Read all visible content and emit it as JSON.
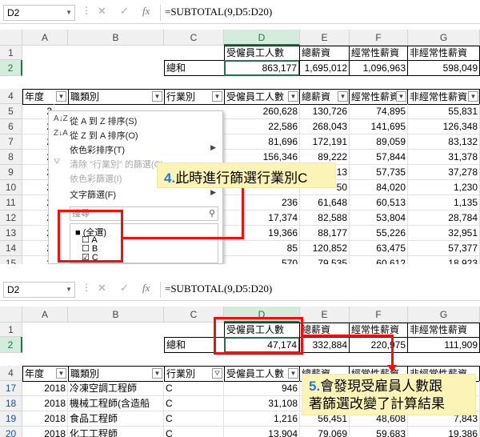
{
  "top": {
    "namebox": "D2",
    "fx": "fx",
    "formula": "=SUBTOTAL(9,D5:D20)",
    "cols": [
      "A",
      "B",
      "C",
      "D",
      "E",
      "F",
      "G"
    ],
    "rows": [
      "1",
      "2",
      "4",
      "5",
      "6",
      "7",
      "8",
      "9",
      "10",
      "11",
      "12",
      "13",
      "14",
      "15"
    ],
    "row1": {
      "d": "受僱員工人數",
      "e": "總薪資",
      "f": "經常性薪資",
      "g": "非經常性薪資"
    },
    "row2": {
      "c": "總和",
      "d": "863,177",
      "e": "1,695,012",
      "f": "1,096,963",
      "g": "598,049"
    },
    "row4": {
      "a": "年度",
      "b": "職類別",
      "c": "行業別",
      "d": "受僱員工人數",
      "e": "總薪資",
      "f": "經常性薪資",
      "g": "非經常性薪資"
    },
    "a_partial": [
      "2",
      "2",
      "2",
      "2",
      "2",
      "2",
      "2",
      "2",
      "2",
      "2",
      "2"
    ],
    "d_vals": [
      "260,628",
      "22,586",
      "81,696",
      "156,346",
      "",
      "",
      "236",
      "17,374",
      "19,366",
      "85",
      "570"
    ],
    "e_vals": [
      "130,726",
      "268,043",
      "172,191",
      "89,222",
      "13",
      "50",
      "61,648",
      "82,588",
      "88,177",
      "120,852",
      "79,535"
    ],
    "f_vals": [
      "74,895",
      "141,695",
      "89,059",
      "57,844",
      "57,735",
      "84,020",
      "60,513",
      "53,804",
      "55,226",
      "63,475",
      "60,612"
    ],
    "g_vals": [
      "55,831",
      "126,348",
      "83,132",
      "31,378",
      "37,278",
      "1,230",
      "1,135",
      "28,784",
      "32,951",
      "57,377",
      "18,923"
    ],
    "menu": {
      "sort_az": "從 A 到 Z 排序(S)",
      "sort_za": "從 Z 到 A 排序(O)",
      "sort_color": "依色彩排序(T)",
      "clear_filter": "清除 \"行業別\" 的篩選(C)",
      "filter_color": "依色彩篩選(I)",
      "text_filter": "文字篩選(F)",
      "search": "搜尋",
      "items": [
        "(全選)",
        "A",
        "B",
        "C"
      ]
    },
    "callout": {
      "num": "4.",
      "text": "此時進行篩選行業別C"
    }
  },
  "bottom": {
    "namebox": "D2",
    "fx": "fx",
    "formula": "=SUBTOTAL(9,D5:D20)",
    "cols": [
      "A",
      "B",
      "C",
      "D",
      "E",
      "F",
      "G"
    ],
    "rows": [
      "1",
      "2",
      "4",
      "17",
      "18",
      "19",
      "20"
    ],
    "row1": {
      "d": "受僱員工人數",
      "e": "總薪資",
      "f": "經常性薪資",
      "g": "非經常性薪資"
    },
    "row2": {
      "c": "總和",
      "d": "47,174",
      "e": "332,884",
      "f": "220,975",
      "g": "111,909"
    },
    "row4": {
      "a": "年度",
      "b": "職類別",
      "c": "行業別",
      "d": "受僱員工人數",
      "e": "總薪資",
      "f": "經常性薪資",
      "g": "非經常性薪資"
    },
    "data": [
      {
        "a": "2018",
        "b": "冷凍空調工程師",
        "c": "C",
        "d": "946",
        "e": "",
        "f": "",
        "g": ""
      },
      {
        "a": "2018",
        "b": "機械工程師(含造船",
        "c": "C",
        "d": "31,108",
        "e": "",
        "f": "",
        "g": ""
      },
      {
        "a": "2018",
        "b": "食品工程師",
        "c": "C",
        "d": "1,216",
        "e": "56,451",
        "f": "48,608",
        "g": "7,843"
      },
      {
        "a": "2018",
        "b": "化工工程師",
        "c": "C",
        "d": "13,904",
        "e": "79,069",
        "f": "59,683",
        "g": "19,386"
      }
    ],
    "callout": {
      "num": "5.",
      "line1": "會發現受雇員人數跟",
      "line2": "著篩選改變了計算結果"
    }
  }
}
